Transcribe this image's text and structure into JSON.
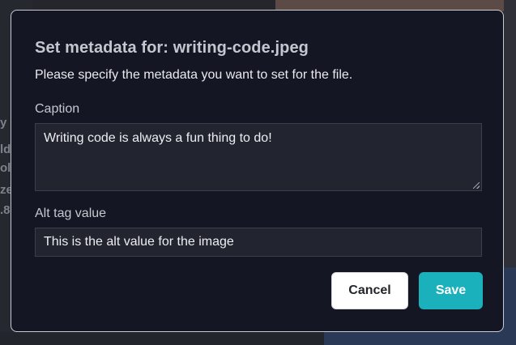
{
  "background": {
    "snippets": [
      "y",
      "ld",
      "olo",
      "ze",
      ".8"
    ]
  },
  "dialog": {
    "title": "Set metadata for: writing-code.jpeg",
    "description": "Please specify the metadata you want to set for the file.",
    "caption_label": "Caption",
    "caption_value": "Writing code is always a fun thing to do!",
    "alt_label": "Alt tag value",
    "alt_value": "This is the alt value for the image",
    "cancel_label": "Cancel",
    "save_label": "Save"
  },
  "colors": {
    "modal_bg": "#141723",
    "field_bg": "#222530",
    "save_accent": "#1ab1bd",
    "cancel_bg": "#ffffff"
  }
}
